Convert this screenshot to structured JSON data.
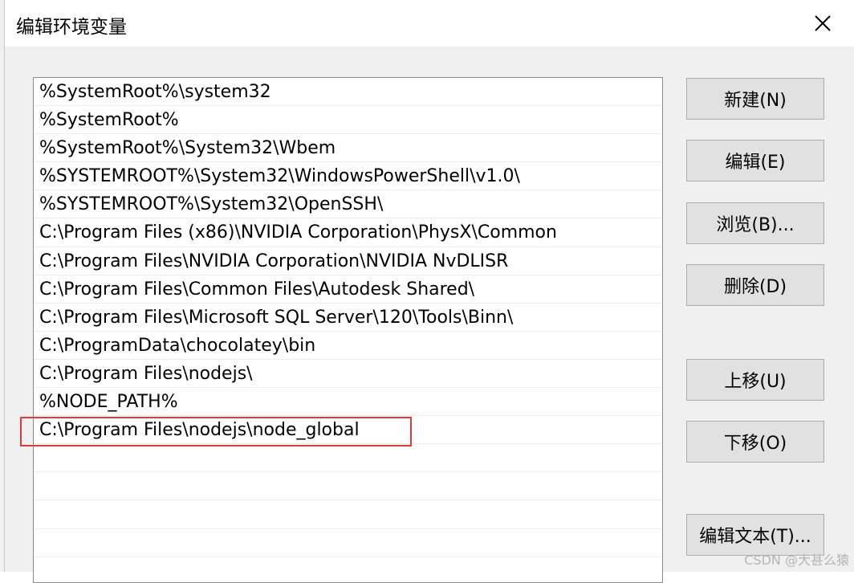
{
  "window": {
    "title": "编辑环境变量"
  },
  "path_list": [
    "%SystemRoot%\\system32",
    "%SystemRoot%",
    "%SystemRoot%\\System32\\Wbem",
    "%SYSTEMROOT%\\System32\\WindowsPowerShell\\v1.0\\",
    "%SYSTEMROOT%\\System32\\OpenSSH\\",
    "C:\\Program Files (x86)\\NVIDIA Corporation\\PhysX\\Common",
    "C:\\Program Files\\NVIDIA Corporation\\NVIDIA NvDLISR",
    "C:\\Program Files\\Common Files\\Autodesk Shared\\",
    "C:\\Program Files\\Microsoft SQL Server\\120\\Tools\\Binn\\",
    "C:\\ProgramData\\chocolatey\\bin",
    "C:\\Program Files\\nodejs\\",
    "%NODE_PATH%",
    "C:\\Program Files\\nodejs\\node_global",
    "",
    "",
    "",
    "",
    ""
  ],
  "buttons": {
    "new": "新建(N)",
    "edit": "编辑(E)",
    "browse": "浏览(B)...",
    "delete": "删除(D)",
    "move_up": "上移(U)",
    "move_down": "下移(O)",
    "edit_text": "编辑文本(T)..."
  },
  "highlight_color": "#e03a3a",
  "watermark": "CSDN @大甚么猿"
}
